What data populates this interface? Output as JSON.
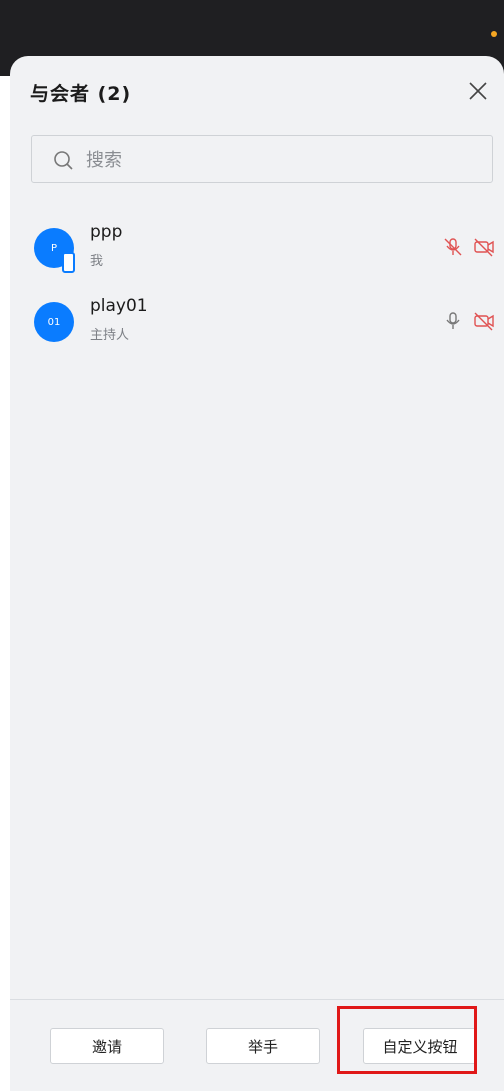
{
  "header": {
    "title": "与会者 (2)"
  },
  "search": {
    "placeholder": "搜索",
    "value": ""
  },
  "participants": [
    {
      "avatar_text": "P",
      "name": "ppp",
      "role": "我",
      "mic": "muted",
      "camera": "off",
      "device": "mobile"
    },
    {
      "avatar_text": "01",
      "name": "play01",
      "role": "主持人",
      "mic": "on",
      "camera": "off"
    }
  ],
  "footer": {
    "invite_label": "邀请",
    "raise_hand_label": "举手",
    "custom_label": "自定义按钮"
  },
  "colors": {
    "avatar": "#0a7cff",
    "muted_red": "#e05252",
    "highlight": "#e01818",
    "status_dot": "#f5a623"
  }
}
